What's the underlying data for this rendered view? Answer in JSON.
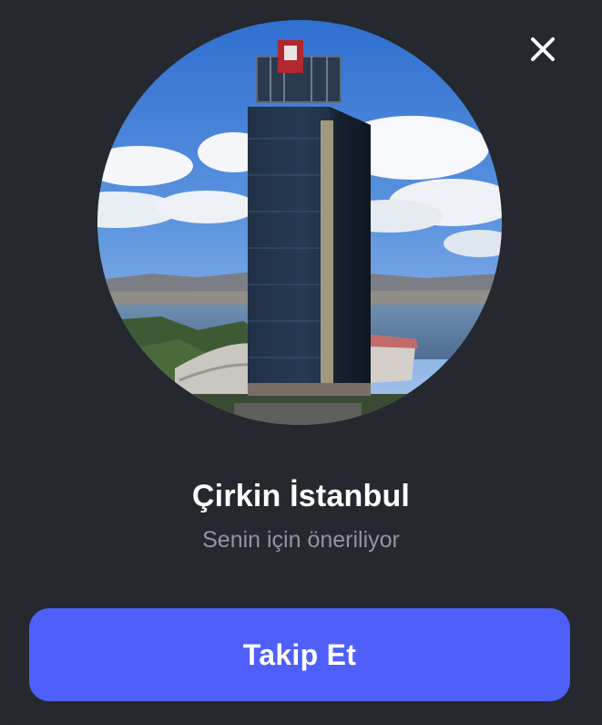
{
  "dialog": {
    "close_icon": "close-icon",
    "profile": {
      "name": "Çirkin İstanbul",
      "subtitle": "Senin için öneriliyor"
    },
    "follow_label": "Takip Et"
  },
  "colors": {
    "background": "#25282e",
    "accent": "#4f5ffb",
    "subtitle": "#8e95a3",
    "text": "#ffffff"
  }
}
